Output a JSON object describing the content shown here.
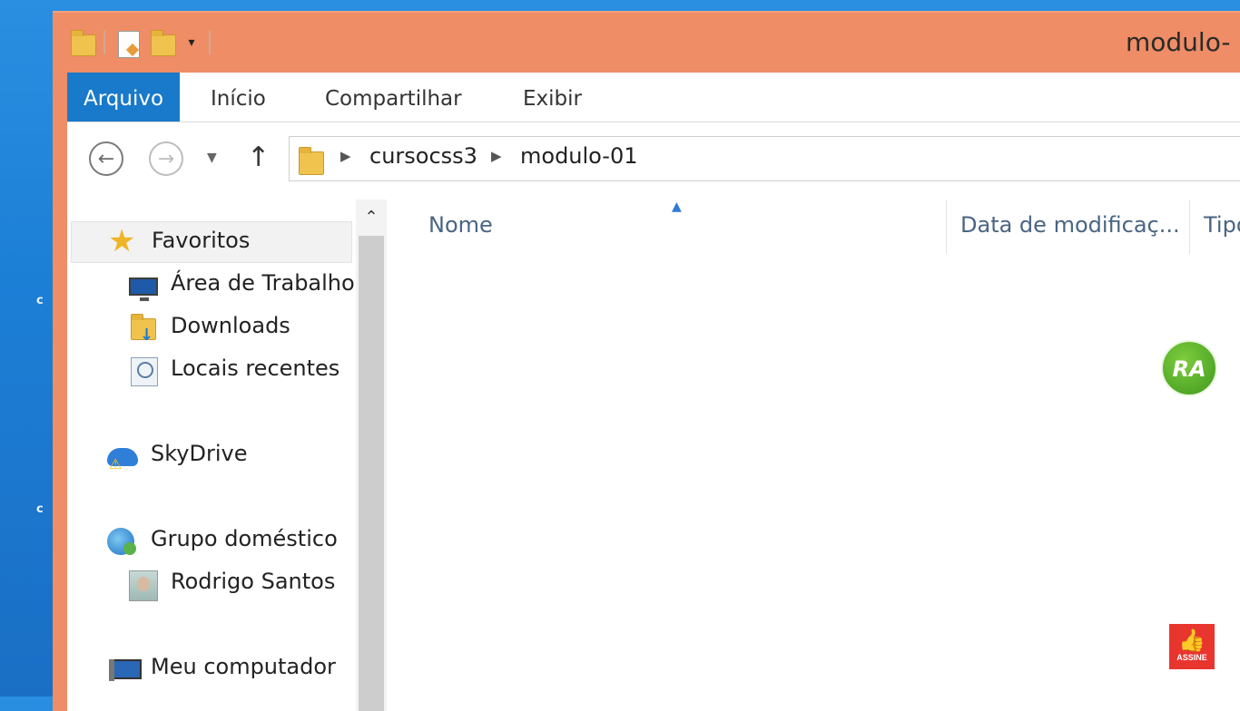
{
  "window": {
    "title": "modulo-"
  },
  "ribbon": {
    "tabs": [
      {
        "label": "Arquivo",
        "active": true
      },
      {
        "label": "Início"
      },
      {
        "label": "Compartilhar"
      },
      {
        "label": "Exibir"
      }
    ]
  },
  "address": {
    "crumbs": [
      "cursocss3",
      "modulo-01"
    ]
  },
  "nav": {
    "favorites": {
      "label": "Favoritos"
    },
    "items": [
      {
        "label": "Área de Trabalho",
        "icon": "desktop-icon"
      },
      {
        "label": "Downloads",
        "icon": "downloads-folder-icon"
      },
      {
        "label": "Locais recentes",
        "icon": "recent-places-icon"
      }
    ],
    "skydrive": {
      "label": "SkyDrive"
    },
    "homegroup": {
      "label": "Grupo doméstico"
    },
    "user": {
      "label": "Rodrigo Santos"
    },
    "computer": {
      "label": "Meu computador"
    }
  },
  "columns": {
    "name": "Nome",
    "modified": "Data de modificaç...",
    "type": "Tipo"
  },
  "overlays": {
    "ra_logo": "RA",
    "subscribe": "ASSINE"
  },
  "colors": {
    "title_bar": "#ef8d66",
    "file_tab": "#1979ca",
    "column_header_text": "#4a6582"
  }
}
